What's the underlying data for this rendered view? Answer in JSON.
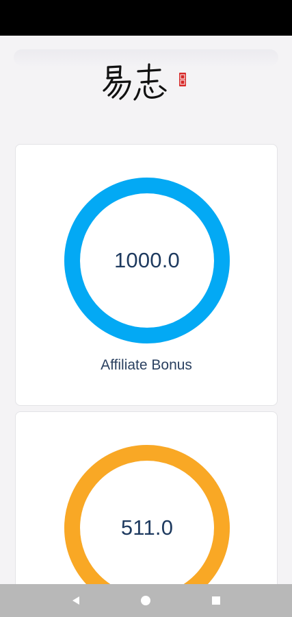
{
  "header": {
    "logo_text": "易志",
    "seal_text": "印"
  },
  "cards": [
    {
      "value": "1000.0",
      "label": "Affiliate Bonus",
      "color": "#03a9f4",
      "fraction": 1.0
    },
    {
      "value": "511.0",
      "label": "",
      "color": "#f9a825",
      "fraction": 1.0
    }
  ],
  "colors": {
    "background": "#f4f3f5",
    "card": "#ffffff",
    "value_text": "#1e3a5f",
    "nav_bar": "#b8b8b8"
  },
  "nav": {
    "back_icon": "back-triangle-icon",
    "home_icon": "home-circle-icon",
    "recents_icon": "recents-square-icon"
  }
}
